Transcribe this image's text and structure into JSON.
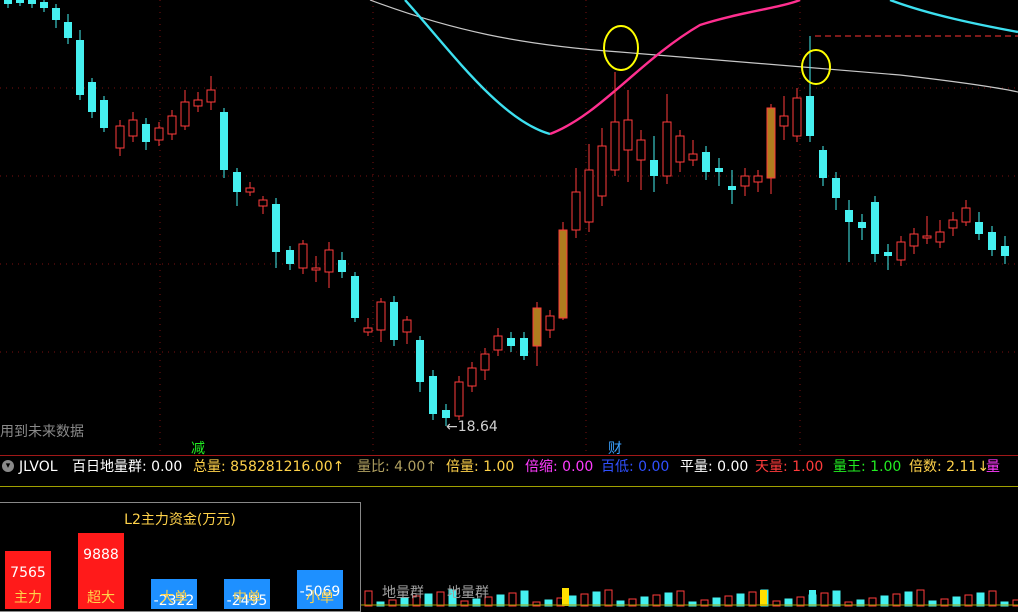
{
  "price_chart": {
    "notice": "用到未来数据",
    "low_marker": "←18.64",
    "event_marks": [
      "减",
      "财"
    ],
    "colors": {
      "up": "#ff3b3b",
      "down": "#45f0f0",
      "flat": "#b07d1f",
      "ma_cyan": "#3de0f0",
      "ma_pink": "#ff2f8f",
      "ma_white": "#c8c8c8",
      "circle": "#ffff00",
      "grid": "#7a1010"
    }
  },
  "indicator": {
    "name": "JLVOL",
    "items": [
      {
        "label": "百日地量群:",
        "value": "0.00",
        "color": "#ffffff"
      },
      {
        "label": "总量:",
        "value": "858281216.00↑",
        "color": "#ffd24a"
      },
      {
        "label": "量比:",
        "value": "4.00↑",
        "color": "#b0a060"
      },
      {
        "label": "倍量:",
        "value": "1.00",
        "color": "#ffd24a"
      },
      {
        "label": "倍缩:",
        "value": "0.00",
        "color": "#ff3cff"
      },
      {
        "label": "百低:",
        "value": "0.00",
        "color": "#3050ff"
      },
      {
        "label": "平量:",
        "value": "0.00",
        "color": "#ffffff"
      },
      {
        "label": "天量:",
        "value": "1.00",
        "color": "#ff3b3b"
      },
      {
        "label": "量王:",
        "value": "1.00",
        "color": "#22ee22"
      },
      {
        "label": "倍数:",
        "value": "2.11↓",
        "color": "#ffd24a"
      },
      {
        "label": "量",
        "value": "",
        "color": "#ff3cff"
      }
    ]
  },
  "fund_flow": {
    "title": "L2主力资金(万元)",
    "bars": [
      {
        "label": "主力",
        "value": "7565",
        "num": 7565,
        "color": "#ff1a1a"
      },
      {
        "label": "超大",
        "value": "9888",
        "num": 9888,
        "color": "#ff1a1a"
      },
      {
        "label": "大单",
        "value": "-2322",
        "num": -2322,
        "color": "#1e90ff"
      },
      {
        "label": "中单",
        "value": "-2495",
        "num": -2495,
        "color": "#1e90ff"
      },
      {
        "label": "小单",
        "value": "-5069",
        "num": -5069,
        "color": "#1e90ff"
      }
    ]
  },
  "volume": {
    "labels": [
      "地量群",
      "地量群"
    ]
  }
}
